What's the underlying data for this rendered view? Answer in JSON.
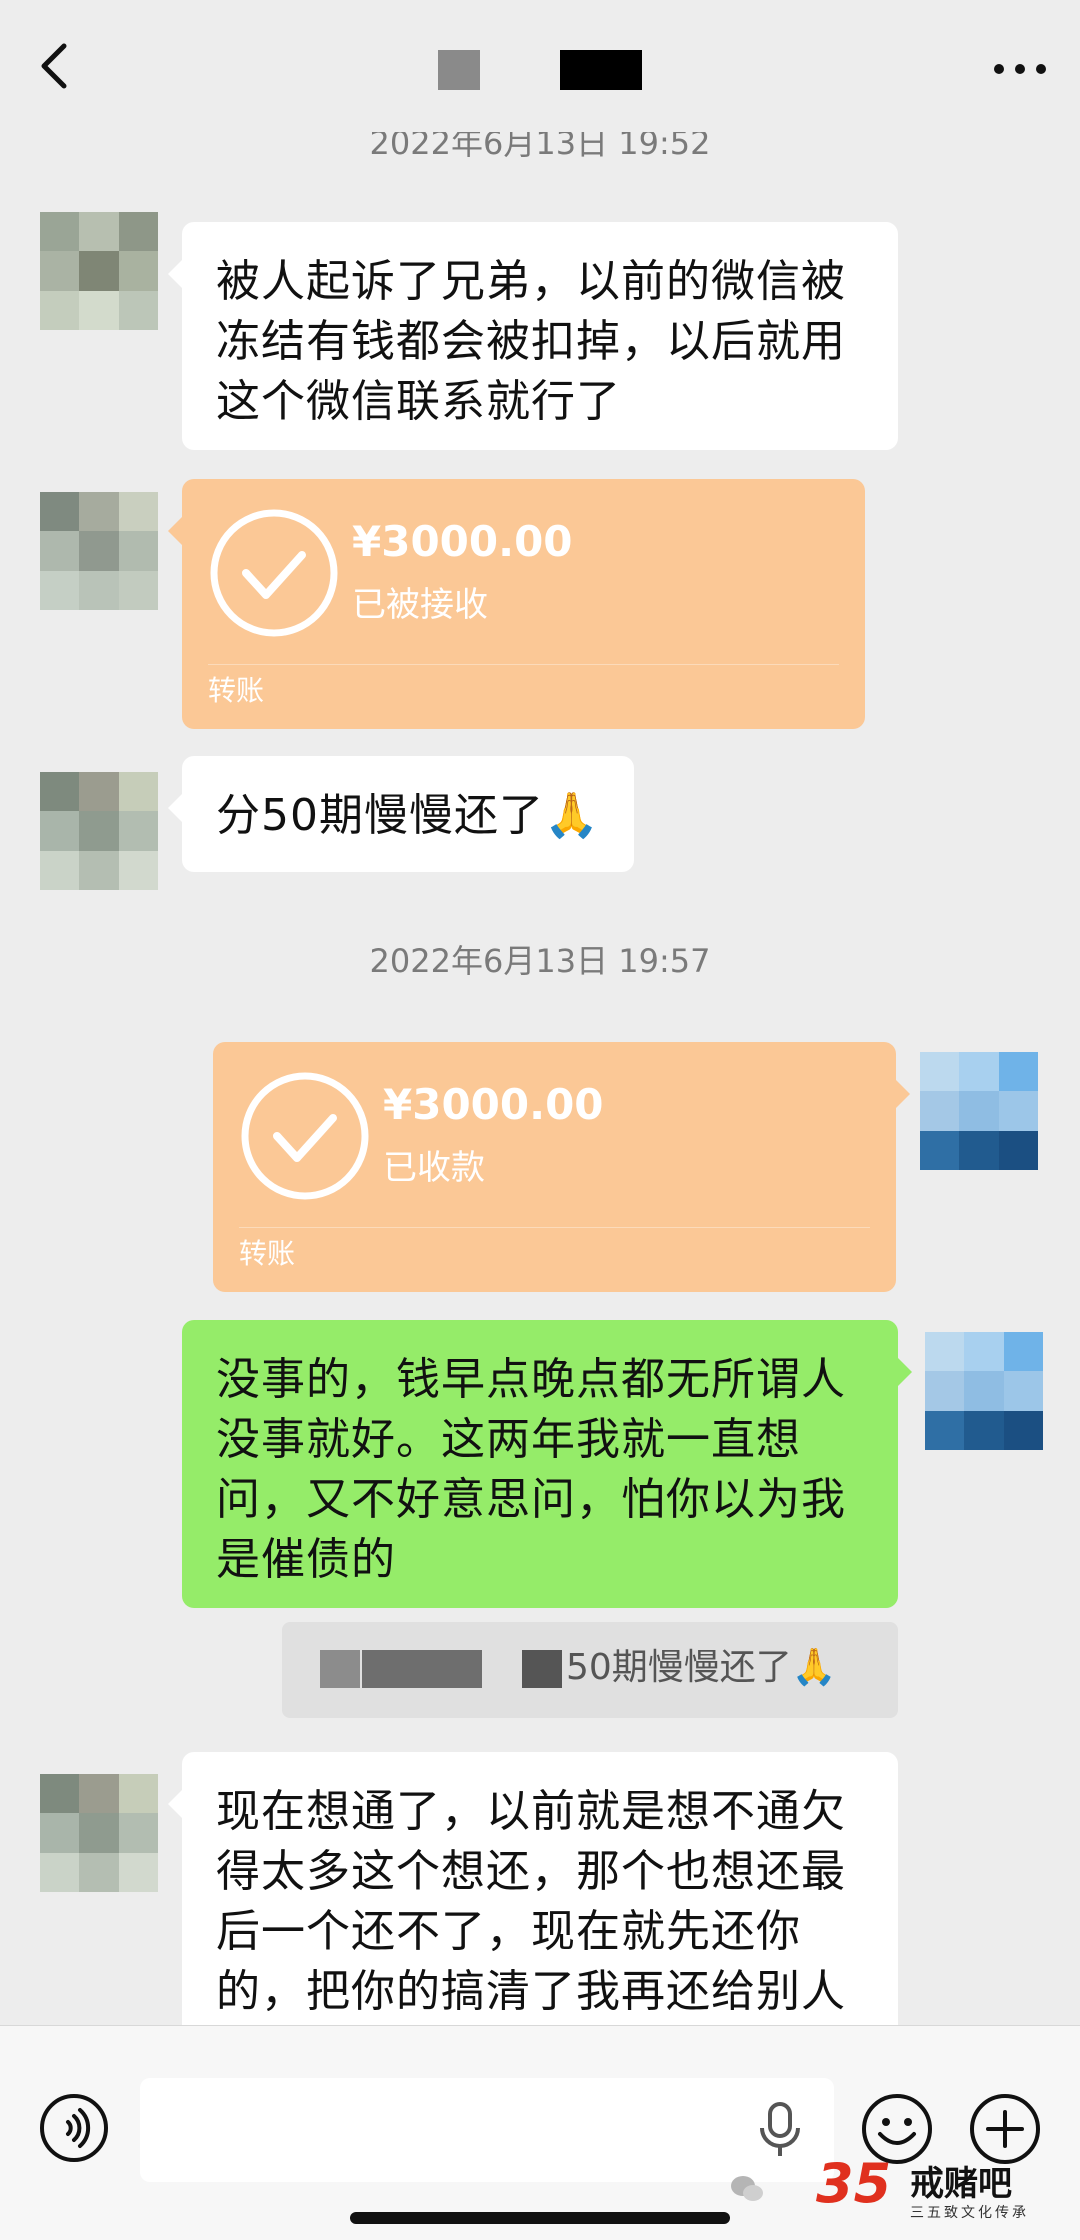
{
  "header": {
    "back_icon": "chevron-left-icon",
    "more_icon": "more-dots-icon"
  },
  "messages": {
    "ts1": "2022年6月13日 19:52",
    "msg1": "被人起诉了兄弟，以前的微信被冻结有钱都会被扣掉，以后就用这个微信联系就行了",
    "transfer1": {
      "amount": "¥3000.00",
      "status": "已被接收",
      "kind": "转账"
    },
    "msg2": "分50期慢慢还了🙏",
    "ts2": "2022年6月13日 19:57",
    "transfer2": {
      "amount": "¥3000.00",
      "status": "已收款",
      "kind": "转账"
    },
    "msg3": "没事的，钱早点晚点都无所谓人没事就好。这两年我就一直想问，又不好意思问，怕你以为我是催债的",
    "quote": "50期慢慢还了🙏",
    "msg4": "现在想通了，以前就是想不通欠得太多这个想还，那个也想还最后一个还不了，现在就先还你的，把你的搞清了我再还给别人"
  },
  "input": {
    "placeholder": "",
    "voice_icon": "voice-icon",
    "mic_icon": "mic-icon",
    "emoji_icon": "emoji-icon",
    "plus_icon": "plus-icon"
  },
  "watermark": {
    "number": "35",
    "name": "戒赌吧",
    "subtitle": "三五致文化传承"
  },
  "colors": {
    "background": "#ededed",
    "green_bubble": "#95ec69",
    "transfer": "#fbc896"
  }
}
